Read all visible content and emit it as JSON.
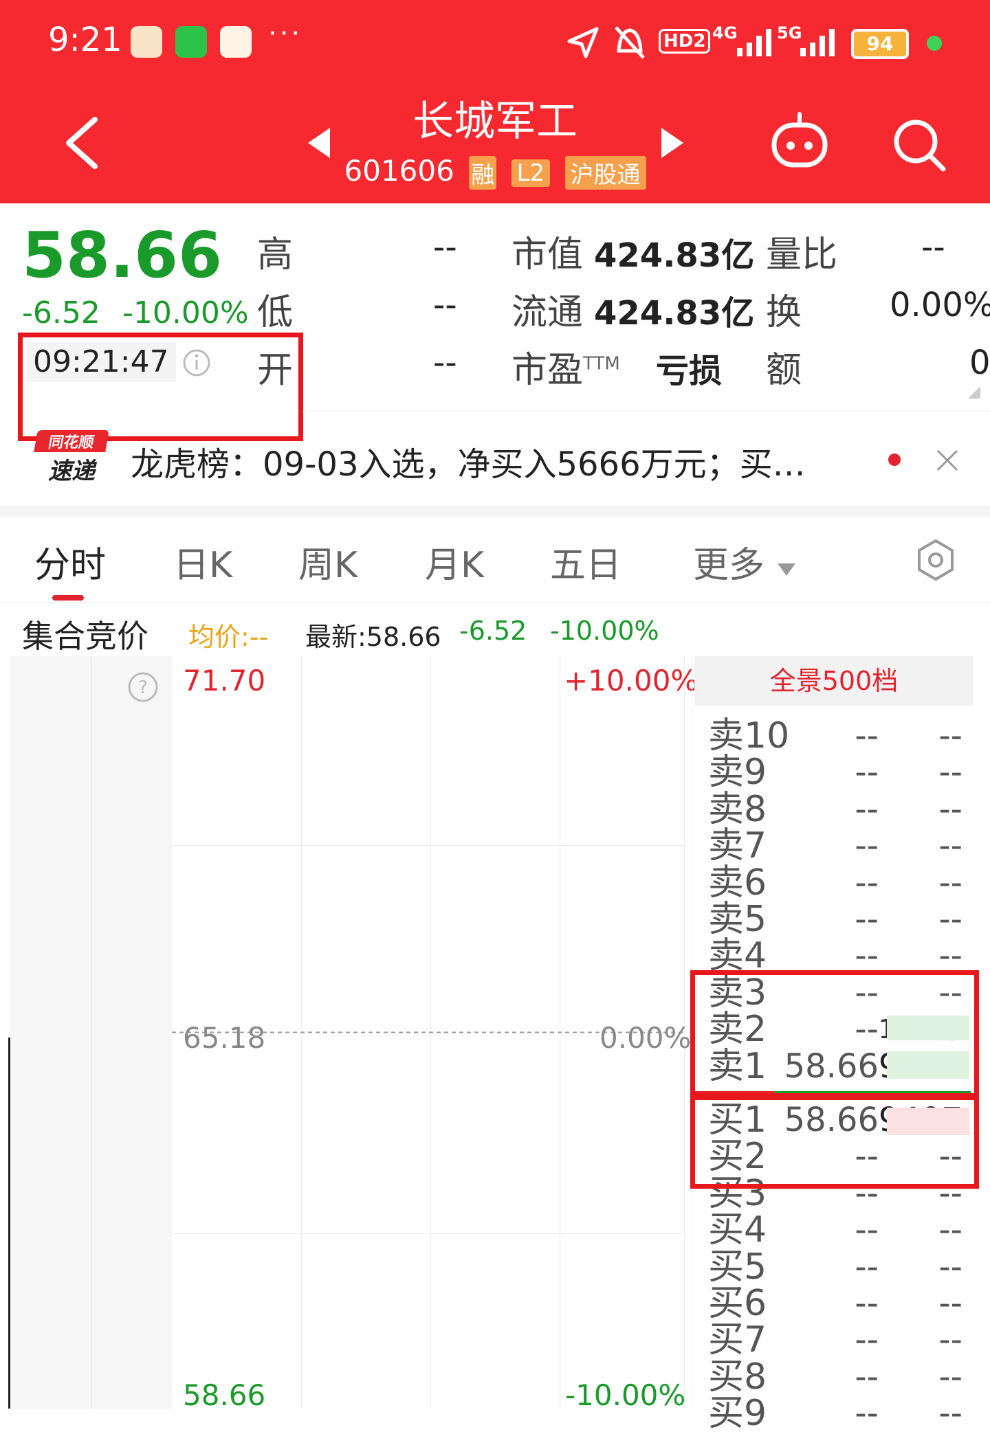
{
  "status_bar": {
    "time": "9:21",
    "more_dots": "···",
    "hd": "HD2",
    "net1": "4G",
    "net2": "5G",
    "battery": "94"
  },
  "nav": {
    "title": "长城军工",
    "code": "601606",
    "tag_mark": "融",
    "tag_l2": "L2",
    "tag_connect": "沪股通"
  },
  "quote": {
    "price": "58.66",
    "change": "-6.52",
    "change_pct": "-10.00%",
    "time": "09:21:47",
    "high_label": "高",
    "high_value": "--",
    "low_label": "低",
    "low_value": "--",
    "open_label": "开",
    "open_value": "--",
    "mcap_label": "市值",
    "mcap_value": "424.83亿",
    "float_label": "流通",
    "float_value": "424.83亿",
    "pe_label": "市盈",
    "pe_sup": "TTM",
    "pe_value": "亏损",
    "vr_label": "量比",
    "vr_value": "--",
    "turnover_label": "换",
    "turnover_value": "0.00%",
    "amount_label": "额",
    "amount_value": "0"
  },
  "news": {
    "badge_top": "同花顺",
    "badge_bottom": "速递",
    "text": "龙虎榜：09-03入选，净买入5666万元；买…"
  },
  "tabs": [
    "分时",
    "日K",
    "周K",
    "月K",
    "五日",
    "更多"
  ],
  "chart_header": {
    "phase": "集合竞价",
    "avg_label": "均价:--",
    "latest_label": "最新:58.66",
    "change": "-6.52",
    "change_pct": "-10.00%"
  },
  "chart_data": {
    "type": "line",
    "title": "",
    "xlabel": "",
    "ylabel": "",
    "ylim": [
      58.66,
      71.7
    ],
    "y_tick_labels_left": [
      "71.70",
      "65.18",
      "58.66"
    ],
    "y_tick_labels_right": [
      "+10.00%",
      "0.00%",
      "-10.00%"
    ],
    "prev_close": 65.18,
    "grid": true,
    "series": []
  },
  "order_book": {
    "header": "全景500档",
    "asks": [
      {
        "name": "卖10",
        "price": "--",
        "qty": "--"
      },
      {
        "name": "卖9",
        "price": "--",
        "qty": "--"
      },
      {
        "name": "卖8",
        "price": "--",
        "qty": "--"
      },
      {
        "name": "卖7",
        "price": "--",
        "qty": "--"
      },
      {
        "name": "卖6",
        "price": "--",
        "qty": "--"
      },
      {
        "name": "卖5",
        "price": "--",
        "qty": "--"
      },
      {
        "name": "卖4",
        "price": "--",
        "qty": "--"
      },
      {
        "name": "卖3",
        "price": "--",
        "qty": "--"
      },
      {
        "name": "卖2",
        "price": "--",
        "qty": "1.47万"
      },
      {
        "name": "卖1",
        "price": "58.66",
        "qty": "9407"
      }
    ],
    "bids": [
      {
        "name": "买1",
        "price": "58.66",
        "qty": "9407"
      },
      {
        "name": "买2",
        "price": "--",
        "qty": "--"
      },
      {
        "name": "买3",
        "price": "--",
        "qty": "--"
      },
      {
        "name": "买4",
        "price": "--",
        "qty": "--"
      },
      {
        "name": "买5",
        "price": "--",
        "qty": "--"
      },
      {
        "name": "买6",
        "price": "--",
        "qty": "--"
      },
      {
        "name": "买7",
        "price": "--",
        "qty": "--"
      },
      {
        "name": "买8",
        "price": "--",
        "qty": "--"
      },
      {
        "name": "买9",
        "price": "--",
        "qty": "--"
      }
    ]
  },
  "colors": {
    "header_red": "#f5292f",
    "down_green": "#1a9a2a",
    "up_red": "#e2242e",
    "avg_orange": "#e8a317",
    "highlight_box": "#e8171c"
  }
}
